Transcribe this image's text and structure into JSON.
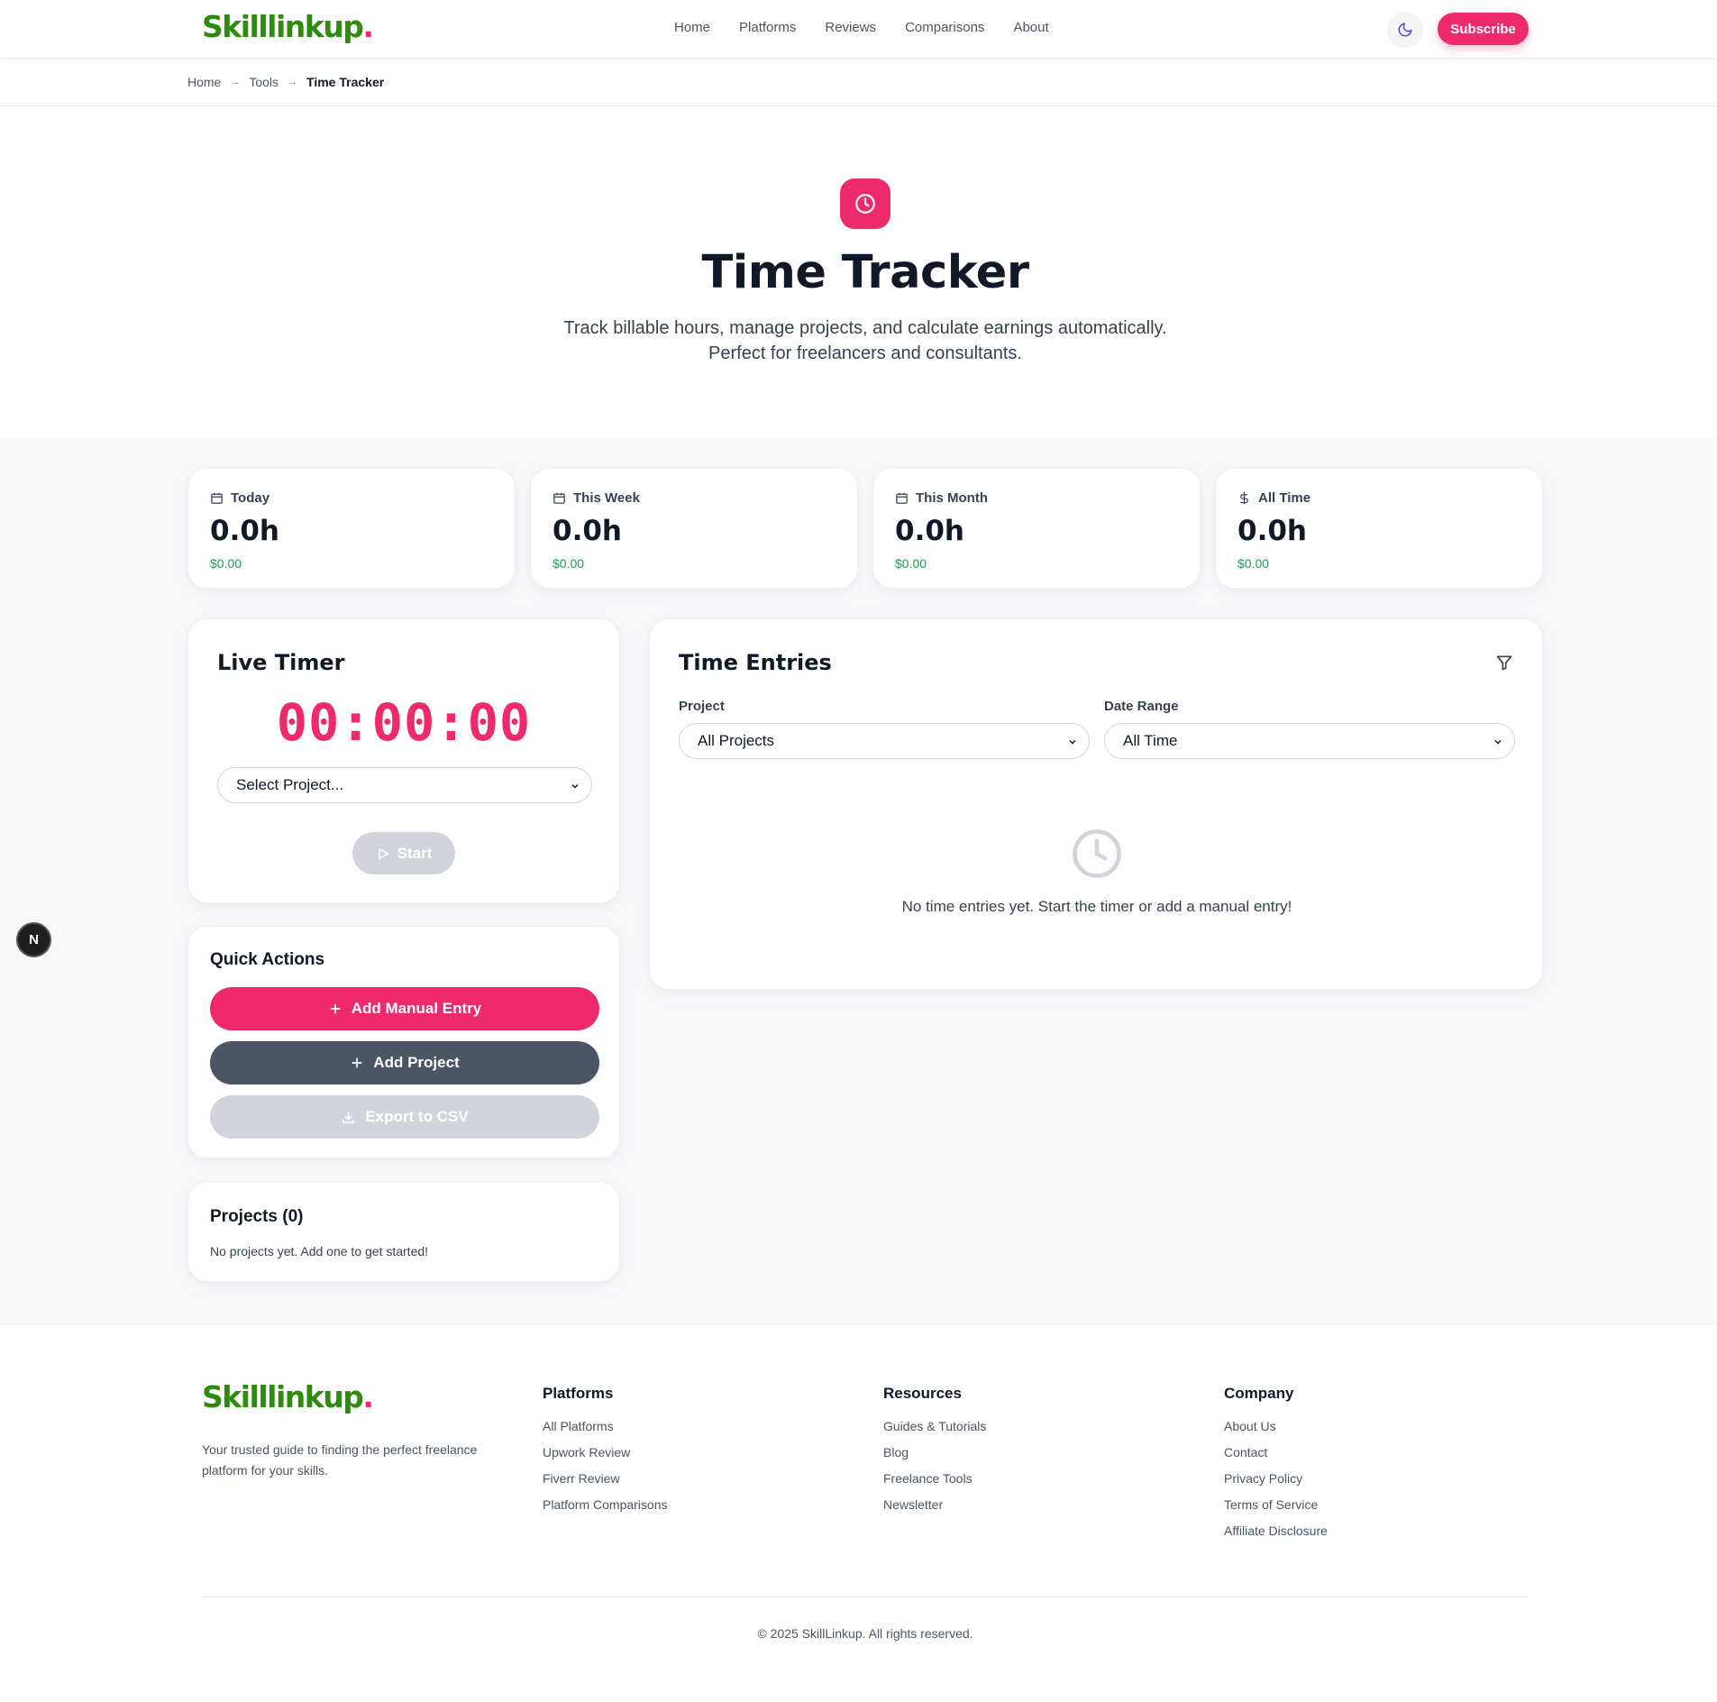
{
  "brand": {
    "name": "Skilllinkup",
    "dot": "."
  },
  "nav": {
    "items": [
      "Home",
      "Platforms",
      "Reviews",
      "Comparisons",
      "About"
    ]
  },
  "header": {
    "subscribe_label": "Subscribe",
    "theme_icon": "moon-icon"
  },
  "breadcrumb": {
    "items": [
      "Home",
      "Tools",
      "Time Tracker"
    ],
    "separator": "→"
  },
  "hero": {
    "icon": "clock-icon",
    "title": "Time Tracker",
    "subtitle_line1": "Track billable hours, manage projects, and calculate earnings automatically.",
    "subtitle_line2": "Perfect for freelancers and consultants."
  },
  "stats": [
    {
      "label": "Today",
      "icon": "calendar-icon",
      "hours": "0.0h",
      "amount": "$0.00"
    },
    {
      "label": "This Week",
      "icon": "calendar-icon",
      "hours": "0.0h",
      "amount": "$0.00"
    },
    {
      "label": "This Month",
      "icon": "calendar-icon",
      "hours": "0.0h",
      "amount": "$0.00"
    },
    {
      "label": "All Time",
      "icon": "dollar-icon",
      "hours": "0.0h",
      "amount": "$0.00"
    }
  ],
  "timer": {
    "title": "Live Timer",
    "display": "00:00:00",
    "project_select": "Select Project...",
    "start_label": "Start"
  },
  "quick_actions": {
    "title": "Quick Actions",
    "add_entry_label": "Add Manual Entry",
    "add_project_label": "Add Project",
    "export_label": "Export to CSV"
  },
  "projects": {
    "title": "Projects (0)",
    "empty": "No projects yet. Add one to get started!"
  },
  "entries": {
    "title": "Time Entries",
    "project_label": "Project",
    "project_value": "All Projects",
    "date_label": "Date Range",
    "date_value": "All Time",
    "empty": "No time entries yet. Start the timer or add a manual entry!"
  },
  "footer": {
    "description": "Your trusted guide to finding the perfect freelance platform for your skills.",
    "columns": [
      {
        "title": "Platforms",
        "links": [
          "All Platforms",
          "Upwork Review",
          "Fiverr Review",
          "Platform Comparisons"
        ]
      },
      {
        "title": "Resources",
        "links": [
          "Guides & Tutorials",
          "Blog",
          "Freelance Tools",
          "Newsletter"
        ]
      },
      {
        "title": "Company",
        "links": [
          "About Us",
          "Contact",
          "Privacy Policy",
          "Terms of Service",
          "Affiliate Disclosure"
        ]
      }
    ],
    "copyright": "© 2025 SkillLinkup. All rights reserved."
  },
  "dev_badge": "N",
  "colors": {
    "accent": "#ef2a6b",
    "brand_green": "#2f8a10",
    "money_green": "#16a34a",
    "dark_button": "#4b5563",
    "disabled": "#d1d5db"
  }
}
